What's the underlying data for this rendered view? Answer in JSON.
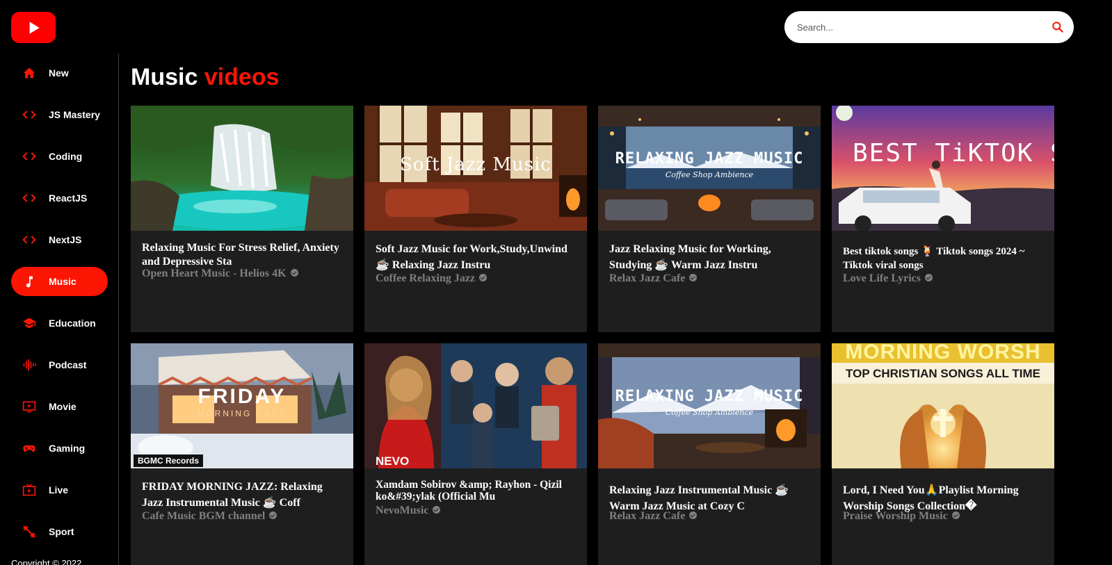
{
  "app": {
    "logo_icon": "play-icon",
    "brand_color": "#fc1503"
  },
  "search": {
    "placeholder": "Search...",
    "icon": "search-icon"
  },
  "sidebar": {
    "items": [
      {
        "label": "New",
        "icon": "home-icon",
        "active": false
      },
      {
        "label": "JS Mastery",
        "icon": "code-icon",
        "active": false
      },
      {
        "label": "Coding",
        "icon": "code-icon",
        "active": false
      },
      {
        "label": "ReactJS",
        "icon": "code-icon",
        "active": false
      },
      {
        "label": "NextJS",
        "icon": "code-icon",
        "active": false
      },
      {
        "label": "Music",
        "icon": "music-note-icon",
        "active": true
      },
      {
        "label": "Education",
        "icon": "graduation-cap-icon",
        "active": false
      },
      {
        "label": "Podcast",
        "icon": "podcast-icon",
        "active": false
      },
      {
        "label": "Movie",
        "icon": "movie-icon",
        "active": false
      },
      {
        "label": "Gaming",
        "icon": "gamepad-icon",
        "active": false
      },
      {
        "label": "Live",
        "icon": "live-tv-icon",
        "active": false
      },
      {
        "label": "Sport",
        "icon": "sport-icon",
        "active": false
      }
    ],
    "copyright": "Copyright © 2022"
  },
  "feed": {
    "title_main": "Music",
    "title_accent": "videos",
    "videos": [
      {
        "title": "Relaxing Music For Stress Relief, Anxiety and Depressive Sta",
        "channel": "Open Heart Music - Helios 4K",
        "thumb_text": ""
      },
      {
        "title": "Soft Jazz Music for Work,Study,Unwind ☕ Relaxing Jazz Instru",
        "channel": "Coffee Relaxing Jazz",
        "thumb_text": "Soft Jazz Music"
      },
      {
        "title": "Jazz Relaxing Music for Working, Studying ☕ Warm Jazz Instru",
        "channel": "Relax Jazz Cafe",
        "thumb_text": "RELAXING JAZZ MUSIC",
        "thumb_sub": "Coffee Shop Ambience"
      },
      {
        "title": "Best tiktok songs 🍹 Tiktok songs 2024 ~ Tiktok viral songs",
        "channel": "Love Life Lyrics",
        "thumb_text": "BEST TiKTOK SONG"
      },
      {
        "title": "FRIDAY MORNING JAZZ: Relaxing Jazz Instrumental Music ☕ Coff",
        "channel": "Cafe Music BGM channel",
        "thumb_text": "FRIDAY",
        "thumb_sub": "MORNING CAFE",
        "thumb_badge": "BGMC Records"
      },
      {
        "title": "Xamdam Sobirov &amp; Rayhon - Qizil ko&#39;ylak (Official Mu",
        "channel": "NevoMusic",
        "thumb_text": "",
        "thumb_badge": "NEVO"
      },
      {
        "title": "Relaxing Jazz Instrumental Music ☕ Warm Jazz Music at Cozy C",
        "channel": "Relax Jazz Cafe",
        "thumb_text": "RELAXING JAZZ MUSIC",
        "thumb_sub": "Coffee Shop Ambience"
      },
      {
        "title": "Lord, I Need You🙏Playlist Morning Worship Songs Collection�",
        "channel": "Praise Worship Music",
        "thumb_text": "MORNING WORSH",
        "thumb_sub": "TOP CHRISTIAN SONGS ALL TIME"
      }
    ]
  }
}
